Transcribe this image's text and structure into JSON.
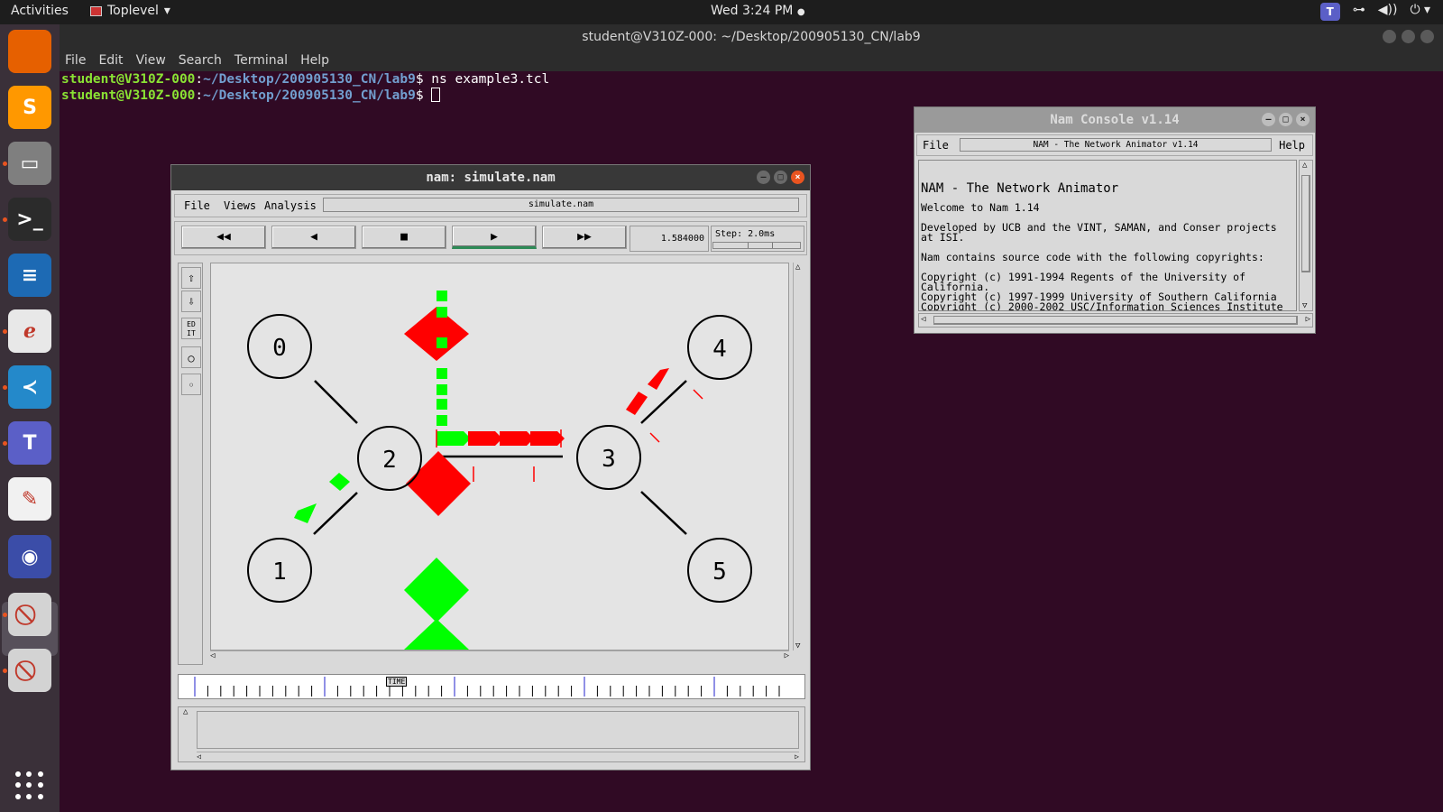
{
  "topbar": {
    "activities": "Activities",
    "app_name": "Toplevel",
    "app_arrow": "▾",
    "clock": "Wed  3:24 PM",
    "clock_dot": "●",
    "tray_teams": "T",
    "tray_network": "⊶",
    "tray_volume": "◀))",
    "tray_power": "⏻ ▾"
  },
  "dock": {
    "apps": [
      {
        "name": "firefox-icon",
        "glyph": "",
        "color": "#e66000"
      },
      {
        "name": "sublime-text-icon",
        "glyph": "S",
        "color": "#ff9800"
      },
      {
        "name": "file-manager-icon",
        "glyph": "▭",
        "color": "#7f7f7f"
      },
      {
        "name": "terminal-icon",
        "glyph": ">_",
        "color": "#2b2b2b"
      },
      {
        "name": "libreoffice-writer-icon",
        "glyph": "≡",
        "color": "#1d6ab4"
      },
      {
        "name": "pdf-viewer-icon",
        "glyph": "ℯ",
        "color": "#e8e8e8"
      },
      {
        "name": "vscode-icon",
        "glyph": "≺",
        "color": "#2489ca"
      },
      {
        "name": "teams-icon",
        "glyph": "T",
        "color": "#5b5fc7"
      },
      {
        "name": "text-editor-icon",
        "glyph": "✎",
        "color": "#f1f1f1"
      },
      {
        "name": "eclipse-icon",
        "glyph": "◉",
        "color": "#3b4da8"
      },
      {
        "name": "tk-window-icon",
        "glyph": "⃠",
        "color": "#d3d3d3"
      },
      {
        "name": "tk-window-icon-2",
        "glyph": "⃠",
        "color": "#d3d3d3"
      }
    ]
  },
  "terminal": {
    "title": "student@V310Z-000: ~/Desktop/200905130_CN/lab9",
    "menu": [
      "File",
      "Edit",
      "View",
      "Search",
      "Terminal",
      "Help"
    ],
    "lines": [
      {
        "user": "student@V310Z-000",
        "path": "~/Desktop/200905130_CN/lab9",
        "cmd": "$ ns example3.tcl"
      },
      {
        "user": "student@V310Z-000",
        "path": "~/Desktop/200905130_CN/lab9",
        "cmd": "$ "
      }
    ]
  },
  "nam": {
    "title": "nam: simulate.nam",
    "menu": [
      "File",
      "Views",
      "Analysis"
    ],
    "filename": "simulate.nam",
    "controls": {
      "rewind": "◀◀",
      "back": "◀",
      "stop": "■",
      "play": "▶",
      "forward": "▶▶"
    },
    "time": "1.584000",
    "step": "Step: 2.0ms",
    "tools": {
      "zoom_in": "⇧",
      "zoom_out": "⇩",
      "edit": "ED IT",
      "node": "○",
      "small_node": "◦"
    },
    "nodes": [
      {
        "id": "0"
      },
      {
        "id": "1"
      },
      {
        "id": "2"
      },
      {
        "id": "3"
      },
      {
        "id": "4"
      },
      {
        "id": "5"
      }
    ],
    "timeline_label": "TIME",
    "colors": {
      "tcp": "#ff0000",
      "udp": "#00ff00",
      "link": "#000000"
    }
  },
  "console": {
    "title": "Nam Console v1.14",
    "menu_file": "File",
    "menu_help": "Help",
    "caption": "NAM - The Network Animator v1.14",
    "heading": "NAM - The Network Animator",
    "lines": [
      "Welcome to Nam 1.14",
      "Developed by UCB and the VINT, SAMAN, and Conser projects at ISI.",
      "Nam contains source code with the following copyrights:",
      "Copyright (c) 1991-1994 Regents of the University of California.",
      "Copyright (c) 1997-1999 University of Southern California",
      "Copyright (c) 2000-2002 USC/Information Sciences Institute"
    ]
  }
}
